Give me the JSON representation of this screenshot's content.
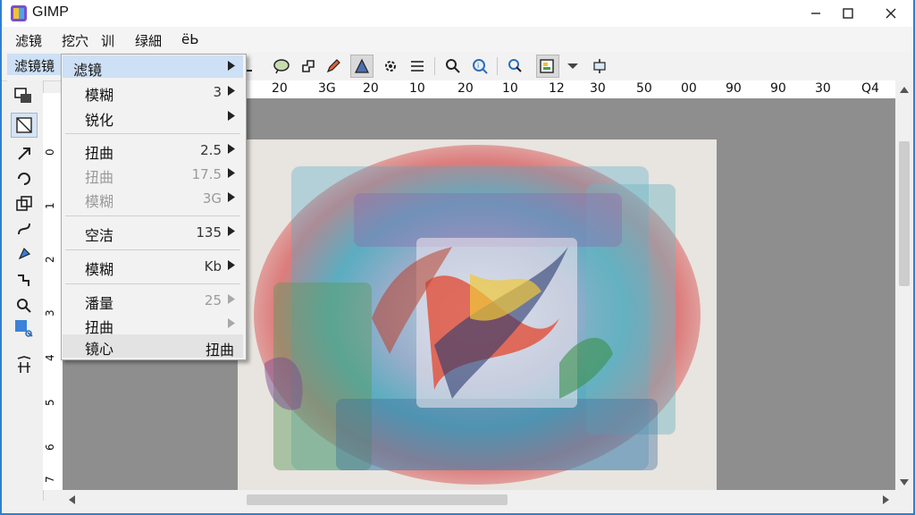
{
  "window": {
    "title": "GIMP"
  },
  "menubar": {
    "items": [
      "滤镜",
      "挖穴",
      "训",
      "绿細",
      "ëЬ"
    ]
  },
  "active_menu": {
    "label": "滤镜镜"
  },
  "dropdown": {
    "header": "滤镜",
    "items": [
      {
        "label": "模糊",
        "value": "3",
        "disabled": false
      },
      {
        "label": "锐化",
        "value": "",
        "disabled": false
      },
      {
        "label": "扭曲",
        "value": "2.5",
        "disabled": false
      },
      {
        "label": "扭曲",
        "value": "17.5",
        "disabled": true
      },
      {
        "label": "模糊",
        "value": "3G",
        "disabled": true
      },
      {
        "label": "空洁",
        "value": "135",
        "disabled": false
      },
      {
        "label": "模糊",
        "value": "Kb",
        "disabled": false
      },
      {
        "label": "潘量",
        "value": "25",
        "disabled": true
      },
      {
        "label": "扭曲",
        "value": "",
        "disabled": true
      },
      {
        "label": "镜心",
        "value": "扭曲",
        "disabled": false
      }
    ]
  },
  "ruler": {
    "horizontal": [
      "20",
      "3G",
      "20",
      "10",
      "20",
      "10",
      "12",
      "30",
      "50",
      "00",
      "90",
      "90",
      "30",
      "Q4"
    ],
    "vertical": [
      "0",
      "1",
      "2",
      "3",
      "4",
      "5",
      "6",
      "7"
    ]
  },
  "colors": {
    "accent": "#2f7fd0",
    "menu_highlight": "#cde0f5",
    "canvas_bg": "#8e8e8e",
    "close_red": "#e81123"
  }
}
